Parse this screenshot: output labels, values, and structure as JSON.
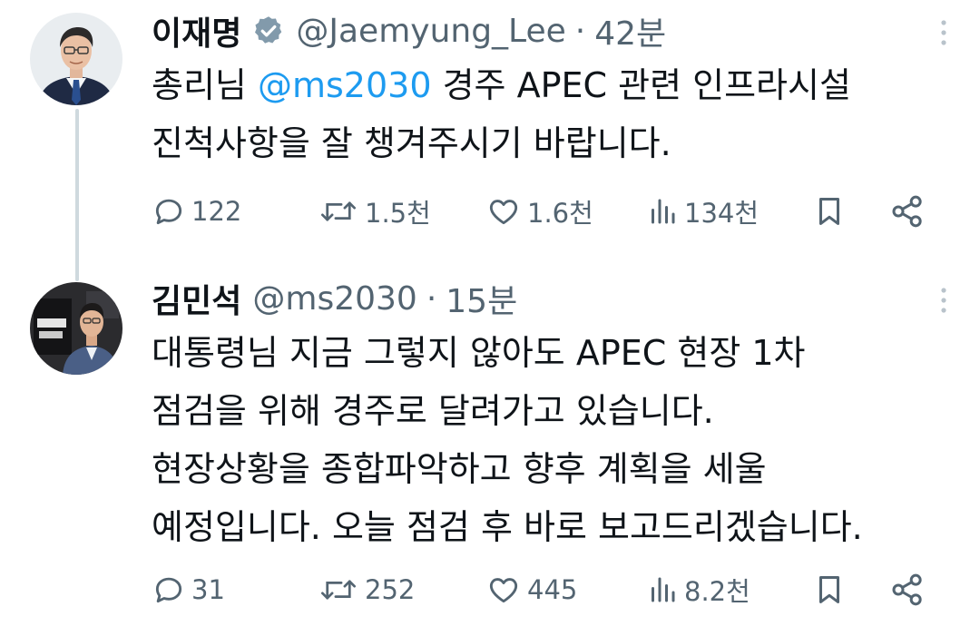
{
  "tweets": [
    {
      "display_name": "이재명",
      "verified": true,
      "handle": "@Jaemyung_Lee",
      "separator": "·",
      "time": "42분",
      "text_lines": [
        {
          "before": "총리님 ",
          "mention": "@ms2030",
          "after": " 경주 APEC 관련 인프라시설"
        },
        {
          "before": "진척사항을 잘 챙겨주시기 바랍니다.",
          "mention": "",
          "after": ""
        }
      ],
      "stats": {
        "replies": "122",
        "reposts": "1.5천",
        "likes": "1.6천",
        "views": "134천"
      }
    },
    {
      "display_name": "김민석",
      "verified": false,
      "handle": "@ms2030",
      "separator": "·",
      "time": "15분",
      "text_lines": [
        {
          "before": "대통령님 지금 그렇지 않아도 APEC 현장 1차",
          "mention": "",
          "after": ""
        },
        {
          "before": "점검을 위해 경주로 달려가고 있습니다.",
          "mention": "",
          "after": ""
        },
        {
          "before": "현장상황을 종합파악하고 향후 계획을 세울",
          "mention": "",
          "after": ""
        },
        {
          "before": "예정입니다. 오늘 점검 후 바로 보고드리겠습니다.",
          "mention": "",
          "after": ""
        }
      ],
      "stats": {
        "replies": "31",
        "reposts": "252",
        "likes": "445",
        "views": "8.2천"
      }
    }
  ],
  "colors": {
    "text": "#0f1419",
    "muted": "#536471",
    "link": "#1d9bf0",
    "thread_line": "#cfd9de",
    "verified_badge": "#829aab"
  },
  "icons": {
    "reply": "reply-bubble-icon",
    "repost": "repost-arrows-icon",
    "like": "heart-icon",
    "views": "bar-chart-icon",
    "bookmark": "bookmark-icon",
    "share": "share-icon",
    "more": "vertical-dots-icon",
    "verified": "verified-badge-icon"
  }
}
